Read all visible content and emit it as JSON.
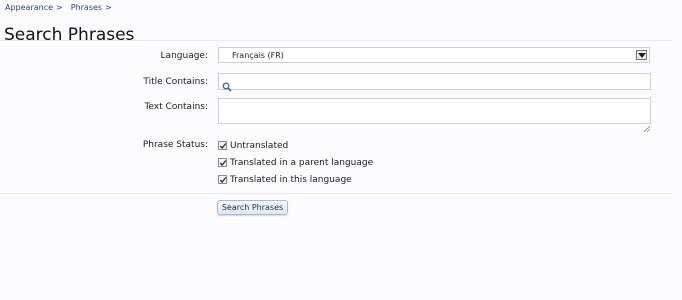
{
  "breadcrumb": {
    "items": [
      {
        "label": "Appearance",
        "sep": ">"
      },
      {
        "label": "Phrases",
        "sep": ">"
      }
    ]
  },
  "page": {
    "title": "Search Phrases"
  },
  "form": {
    "language": {
      "label": "Language:",
      "selected": "Français (FR)"
    },
    "title_contains": {
      "label": "Title Contains:",
      "value": "",
      "icon": "search-icon"
    },
    "text_contains": {
      "label": "Text Contains:",
      "value": ""
    },
    "phrase_status": {
      "label": "Phrase Status:",
      "options": [
        {
          "label": "Untranslated",
          "checked": true
        },
        {
          "label": "Translated in a parent language",
          "checked": true
        },
        {
          "label": "Translated in this language",
          "checked": true
        }
      ]
    },
    "submit_label": "Search Phrases"
  },
  "colors": {
    "link": "#2b4a78",
    "button_border": "#a9bccf",
    "field_border": "#c9d3e0"
  }
}
